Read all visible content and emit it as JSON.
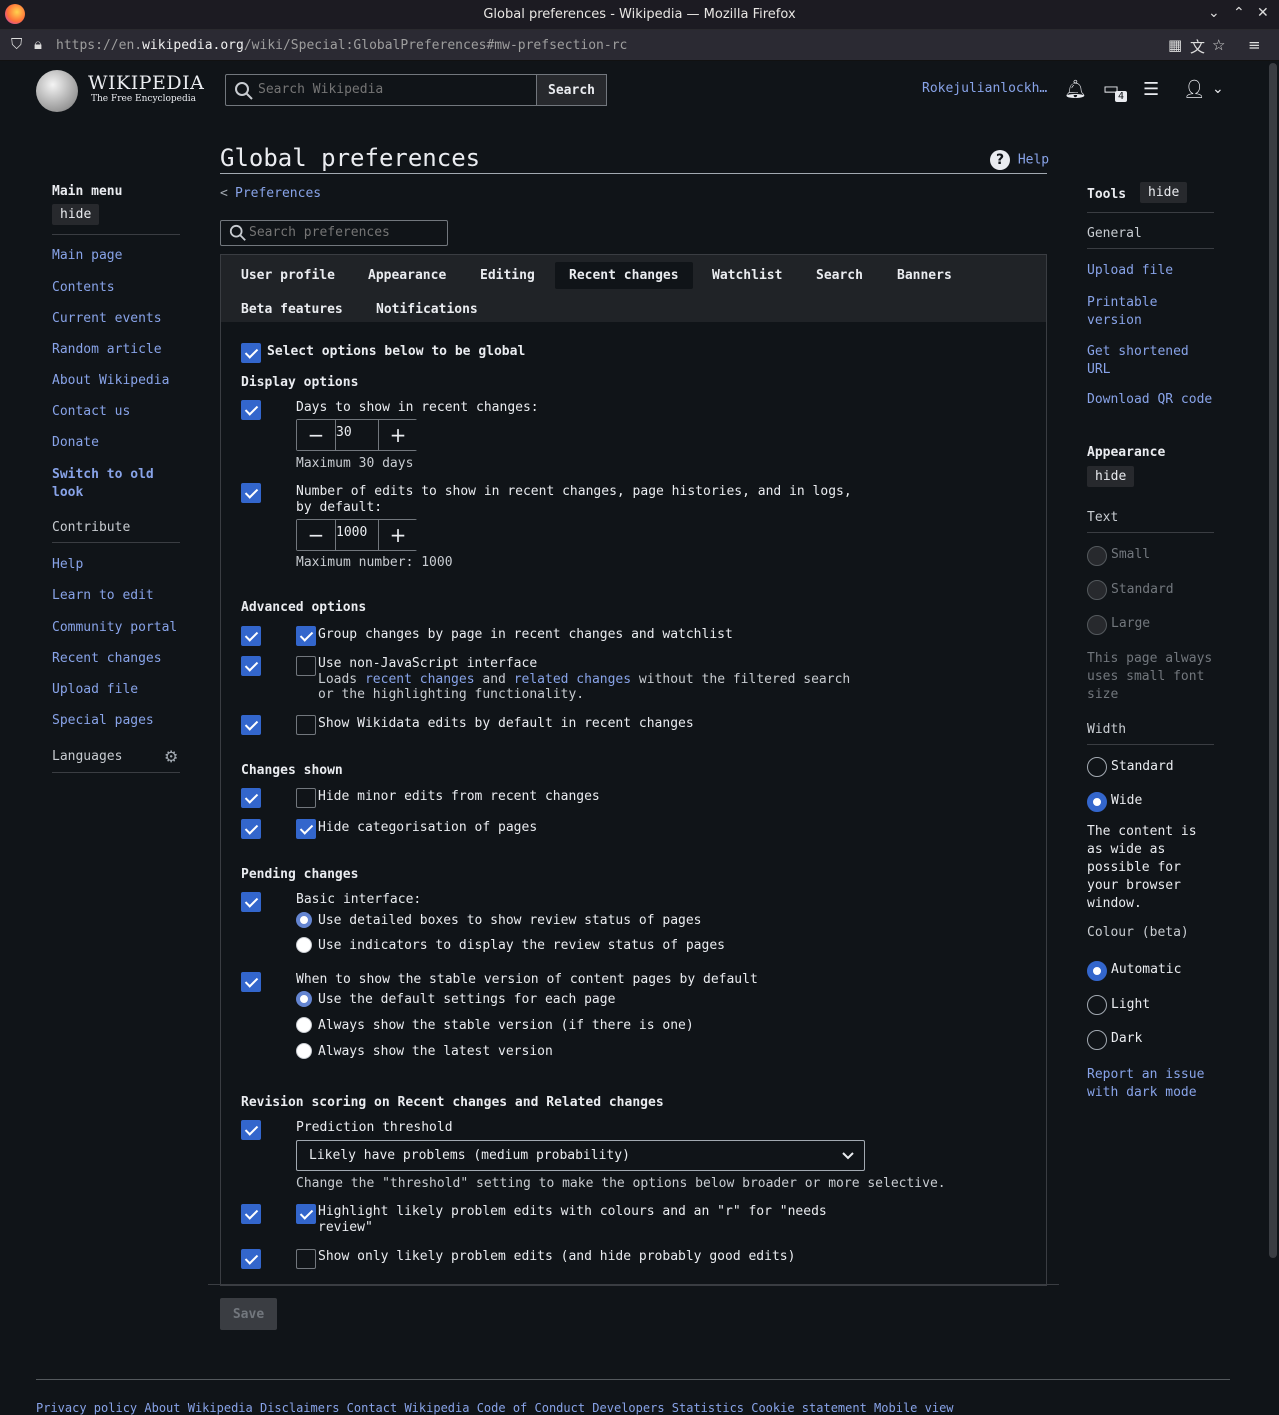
{
  "window": {
    "title": "Global preferences - Wikipedia — Mozilla Firefox"
  },
  "urlbar": {
    "prefix": "https://en.",
    "domain": "wikipedia.org",
    "path": "/wiki/Special:GlobalPreferences#mw-prefsection-rc"
  },
  "header": {
    "wordmark": "WIKIPEDIA",
    "tagline": "The Free Encyclopedia",
    "search_placeholder": "Search Wikipedia",
    "search_button": "Search",
    "username": "Rokejulianlockh…",
    "notices_count": "4"
  },
  "left_menu": {
    "title": "Main menu",
    "hide": "hide",
    "links": [
      "Main page",
      "Contents",
      "Current events",
      "Random article",
      "About Wikipedia",
      "Contact us",
      "Donate"
    ],
    "switch_old_look": "Switch to old look",
    "contribute_title": "Contribute",
    "contribute_links": [
      "Help",
      "Learn to edit",
      "Community portal",
      "Recent changes",
      "Upload file",
      "Special pages"
    ],
    "languages": "Languages"
  },
  "main": {
    "title": "Global preferences",
    "help": "Help",
    "back_link": "Preferences",
    "search_placeholder": "Search preferences",
    "tabs": [
      "User profile",
      "Appearance",
      "Editing",
      "Recent changes",
      "Watchlist",
      "Search",
      "Banners",
      "Beta features",
      "Notifications"
    ],
    "selected_tab": "Recent changes",
    "select_global": "Select options below to be global",
    "display_options": {
      "heading": "Display options",
      "days_label": "Days to show in recent changes:",
      "days_value": "30",
      "days_help": "Maximum 30 days",
      "edits_label_1": "Number of edits to show in recent changes, page histories, and in logs,",
      "edits_label_2": "by default:",
      "edits_value": "1000",
      "edits_help": "Maximum number: 1000"
    },
    "advanced_options": {
      "heading": "Advanced options",
      "group_changes": "Group changes by page in recent changes and watchlist",
      "non_js": "Use non-JavaScript interface",
      "non_js_help_1": "Loads",
      "non_js_link_1": "recent changes",
      "non_js_help_2": "and",
      "non_js_link_2": "related changes",
      "non_js_help_3": "without the filtered search",
      "non_js_help_4": "or the highlighting functionality.",
      "wikidata": "Show Wikidata edits by default in recent changes"
    },
    "changes_shown": {
      "heading": "Changes shown",
      "hide_minor": "Hide minor edits from recent changes",
      "hide_categorisation": "Hide categorisation of pages"
    },
    "pending_changes": {
      "heading": "Pending changes",
      "basic_interface": "Basic interface:",
      "opt_detailed": "Use detailed boxes to show review status of pages",
      "opt_indicators": "Use indicators to display the review status of pages",
      "stable_label": "When to show the stable version of content pages by default",
      "opt_default": "Use the default settings for each page",
      "opt_stable": "Always show the stable version (if there is one)",
      "opt_latest": "Always show the latest version"
    },
    "revision_scoring": {
      "heading": "Revision scoring on Recent changes and Related changes",
      "threshold_label": "Prediction threshold",
      "threshold_value": "Likely have problems (medium probability)",
      "threshold_help": "Change the \"threshold\" setting to make the options below broader or more selective.",
      "highlight_1": "Highlight likely problem edits with colours and an \"r\" for \"needs",
      "highlight_2": "review\"",
      "only_problem": "Show only likely problem edits (and hide probably good edits)"
    },
    "save": "Save"
  },
  "right_tools": {
    "title": "Tools",
    "hide": "hide",
    "general": "General",
    "links": [
      "Upload file",
      "Printable version",
      "Get shortened URL",
      "Download QR code"
    ],
    "appearance_title": "Appearance",
    "appearance_hide": "hide",
    "text_label": "Text",
    "text_options": [
      "Small",
      "Standard",
      "Large"
    ],
    "text_note": "This page always uses small font size",
    "width_label": "Width",
    "width_options": [
      "Standard",
      "Wide"
    ],
    "width_note": "The content is as wide as possible for your browser window.",
    "colour_label": "Colour (beta)",
    "colour_options": [
      "Automatic",
      "Light",
      "Dark"
    ],
    "dark_issue": "Report an issue with dark mode"
  },
  "footer": {
    "text": "Privacy policy   About Wikipedia   Disclaimers   Contact Wikipedia   Code of Conduct   Developers   Statistics   Cookie statement   Mobile view"
  }
}
